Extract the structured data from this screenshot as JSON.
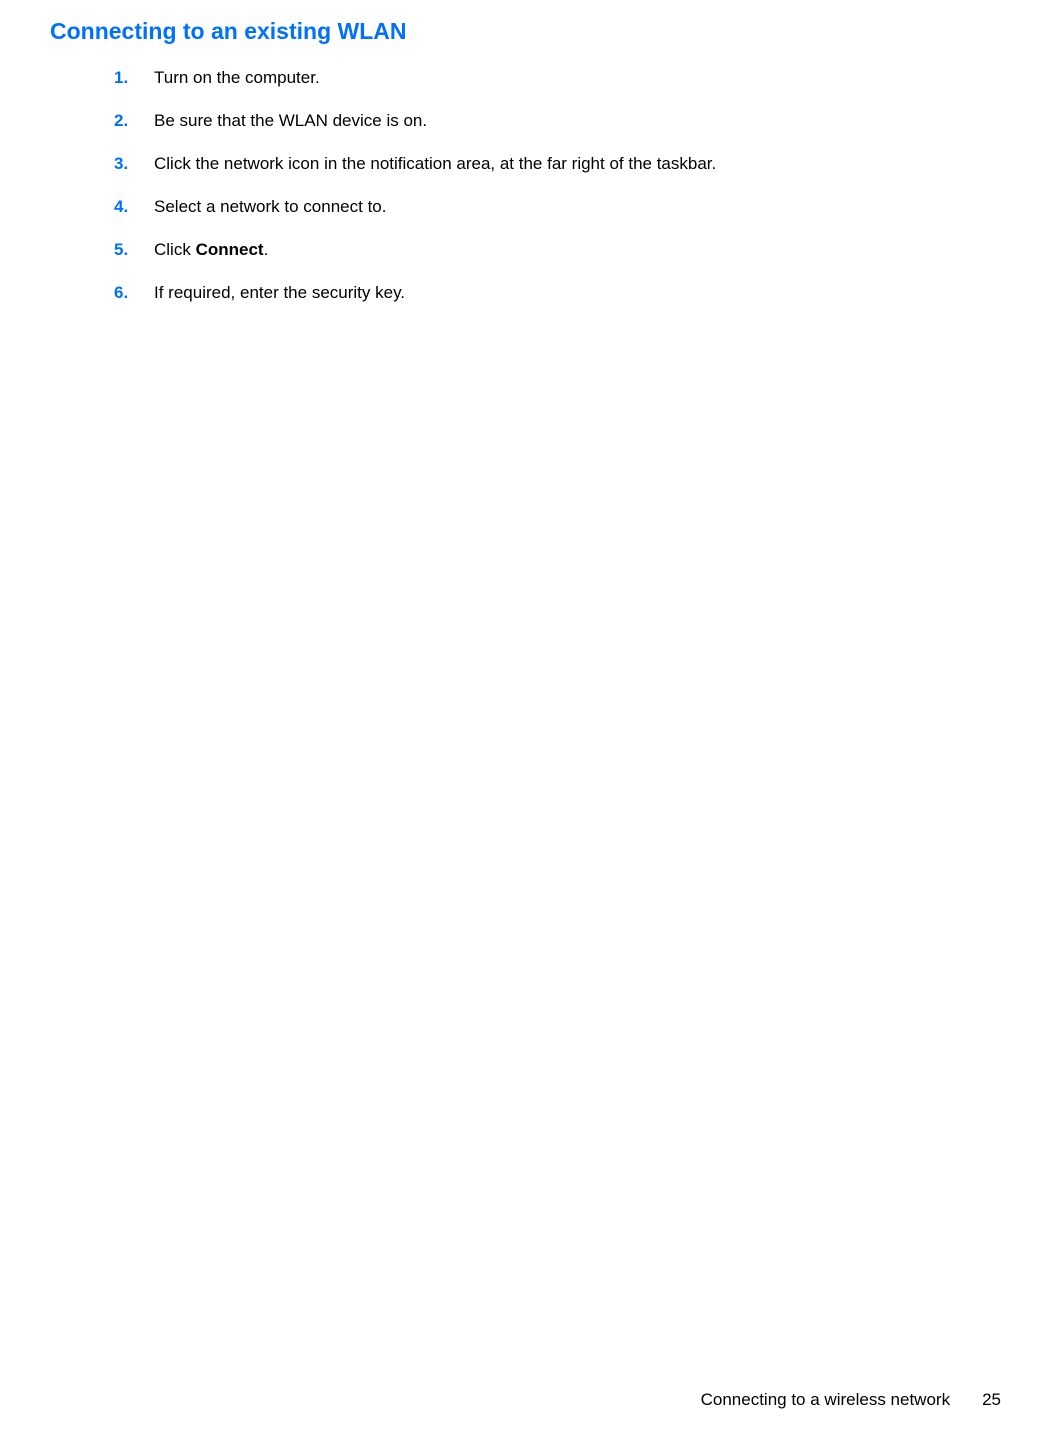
{
  "heading": "Connecting to an existing WLAN",
  "steps": [
    {
      "number": "1.",
      "text": "Turn on the computer."
    },
    {
      "number": "2.",
      "text": "Be sure that the WLAN device is on."
    },
    {
      "number": "3.",
      "text": "Click the network icon in the notification area, at the far right of the taskbar."
    },
    {
      "number": "4.",
      "text": "Select a network to connect to."
    },
    {
      "number": "5.",
      "prefix": "Click ",
      "bold": "Connect",
      "suffix": "."
    },
    {
      "number": "6.",
      "text": "If required, enter the security key."
    }
  ],
  "footer": {
    "title": "Connecting to a wireless network",
    "page": "25"
  }
}
